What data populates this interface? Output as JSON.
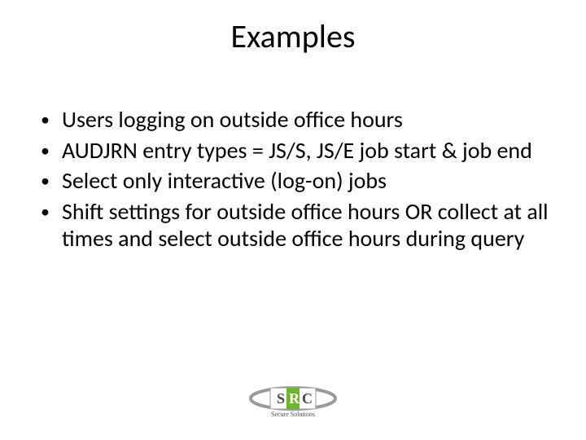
{
  "title": "Examples",
  "bullets": [
    "Users logging on outside office hours",
    "AUDJRN  entry types = JS/S, JS/E job start & job end",
    "Select only interactive (log-on) jobs",
    "Shift settings for outside office hours OR collect at all times and select outside office hours during query"
  ],
  "logo": {
    "letters": [
      "S",
      "R",
      "C"
    ],
    "subtitle": "Secure Solutions",
    "accent": "#6fb62c",
    "frame": "#9a9a9a",
    "text": "#4a4a4a"
  }
}
